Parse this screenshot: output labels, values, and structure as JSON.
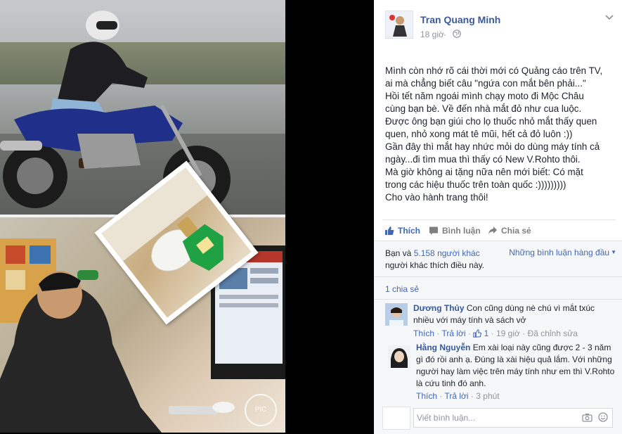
{
  "post": {
    "author": "Tran Quang Minh",
    "time": "18 giờ",
    "time_separator": "·",
    "privacy_icon": "globe-icon",
    "text_lines": [
      "Mình còn nhớ rõ cái thời mới có Quảng cáo trên TV,",
      "ai mà chẳng biết câu \"ngứa con mắt bên phải...\"",
      "Hồi tết năm ngoái mình chạy moto đi Mộc Châu",
      "cùng bạn bè. Về đến nhà mắt đỏ như cua luộc.",
      "Được ông bạn giúi cho lọ thuốc nhỏ mắt thấy quen",
      "quen, nhỏ xong mát tê mũi, hết cả đỏ luôn :))",
      "Gần đây thì mắt hay nhức mỏi do dùng máy tính cả",
      "ngày...đi tìm mua thì thấy có New V.Rohto thôi.",
      "Mà giờ không ai tặng nữa nên mới biết: Có mặt",
      "trong các hiệu thuốc trên toàn quốc :)))))))))",
      "Cho vào hành trang thôi!"
    ]
  },
  "photo": {
    "watermark": "PIC"
  },
  "actions": {
    "like": "Thích",
    "comment": "Bình luận",
    "share": "Chia sẻ"
  },
  "likes_summary": {
    "prefix": "Bạn và ",
    "count_link": "5.158 người khác",
    "suffix": " người khác thích điều này."
  },
  "comment_filter": "Những bình luận hàng đầu",
  "shares": "1 chia sẻ",
  "comments": [
    {
      "author": "Dương Thủy",
      "text": "Con cũng dùng nè chú vì mắt txúc nhiều với máy tính và sách vở",
      "like_label": "Thích",
      "reply_label": "Trả lời",
      "like_count": "1",
      "time": "19 giờ",
      "edited": "Đã chỉnh sửa",
      "separator": "·"
    },
    {
      "author": "Hằng Nguyễn",
      "text": "Em xài loại này cũng được 2 - 3 năm gì đó rồi anh ạ. Đúng là xài hiệu quả lắm. Với những người hay làm việc trên máy tính như em thì V.Rohto là cứu tinh đó anh.",
      "like_label": "Thích",
      "reply_label": "Trả lời",
      "time": "3 phút",
      "separator": "·"
    }
  ],
  "composer": {
    "placeholder": "Viết bình luận..."
  },
  "colors": {
    "link": "#4267b2",
    "author": "#3b5998",
    "meta": "#90949c",
    "panel_bg": "#f6f7f9"
  }
}
